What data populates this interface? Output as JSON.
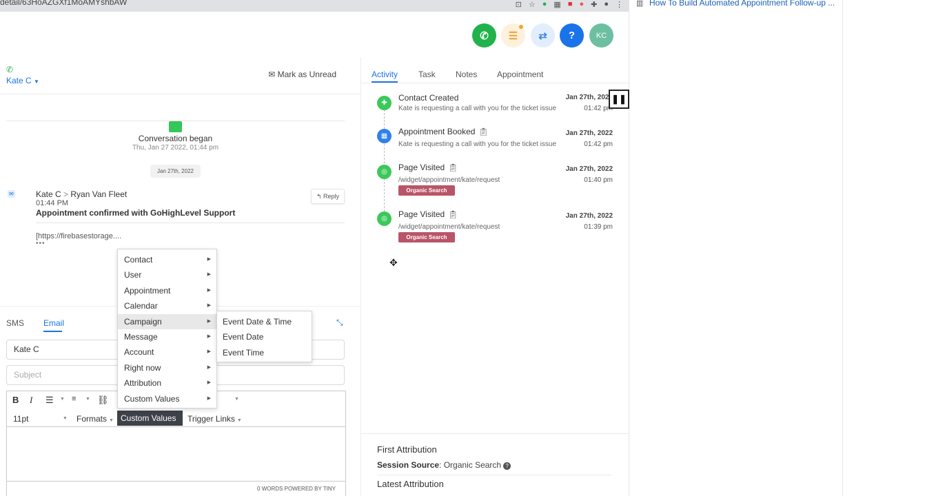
{
  "browser": {
    "url": "detail/63HoAZGXf1MoAMYshbAW",
    "side_title": "How To Build Automated Appointment Follow-up ..."
  },
  "header": {
    "avatar_initials": "KC"
  },
  "contact": {
    "name": "Kate C",
    "mark_unread": "Mark as Unread"
  },
  "conversation": {
    "began_title": "Conversation began",
    "began_date": "Thu, Jan 27 2022, 01:44 pm",
    "date_pill": "Jan 27th, 2022"
  },
  "message": {
    "from": "Kate C",
    "separator": ">",
    "to": "Ryan Van Fleet",
    "time": "01:44 PM",
    "subject": "Appointment confirmed with GoHighLevel Support",
    "reply_label": "Reply",
    "link": "[https://firebasestorage....",
    "more": "•••"
  },
  "composer": {
    "tabs": [
      "SMS",
      "Email"
    ],
    "to_value": "Kate C",
    "subject_placeholder": "Subject",
    "font_size": "11pt",
    "formats_label": "Formats",
    "custom_values_label": "Custom Values",
    "trigger_links_label": "Trigger Links",
    "footer": "0 WORDS POWERED BY TINY"
  },
  "menu": {
    "items": [
      "Contact",
      "User",
      "Appointment",
      "Calendar",
      "Campaign",
      "Message",
      "Account",
      "Right now",
      "Attribution",
      "Custom Values"
    ],
    "active_index": 4,
    "submenu": [
      "Event Date & Time",
      "Event Date",
      "Event Time"
    ]
  },
  "activity": {
    "tabs": [
      "Activity",
      "Task",
      "Notes",
      "Appointment"
    ],
    "items": [
      {
        "title": "Contact Created",
        "desc": "Kate is requesting a call with you for the ticket issue",
        "date": "Jan 27th, 2022",
        "time": "01:42 pm",
        "icon": "person-add-icon",
        "color": "#3cc85a"
      },
      {
        "title": "Appointment Booked",
        "desc": "Kate is requesting a call with you for the ticket issue",
        "date": "Jan 27th, 2022",
        "time": "01:42 pm",
        "icon": "calendar-icon",
        "color": "#2f80ed"
      },
      {
        "title": "Page Visited",
        "desc": "/widget/appointment/kate/request",
        "badge": "Organic Search",
        "date": "Jan 27th, 2022",
        "time": "01:40 pm",
        "icon": "globe-icon",
        "color": "#3cc85a"
      },
      {
        "title": "Page Visited",
        "desc": "/widget/appointment/kate/request",
        "badge": "Organic Search",
        "date": "Jan 27th, 2022",
        "time": "01:39 pm",
        "icon": "globe-icon",
        "color": "#3cc85a"
      }
    ]
  },
  "attribution": {
    "first_title": "First Attribution",
    "session_label": "Session Source",
    "session_value": "Organic Search",
    "latest_title": "Latest Attribution"
  },
  "colors": {
    "accent": "#1a73e8",
    "green": "#22b24c",
    "badge": "#b95568"
  }
}
